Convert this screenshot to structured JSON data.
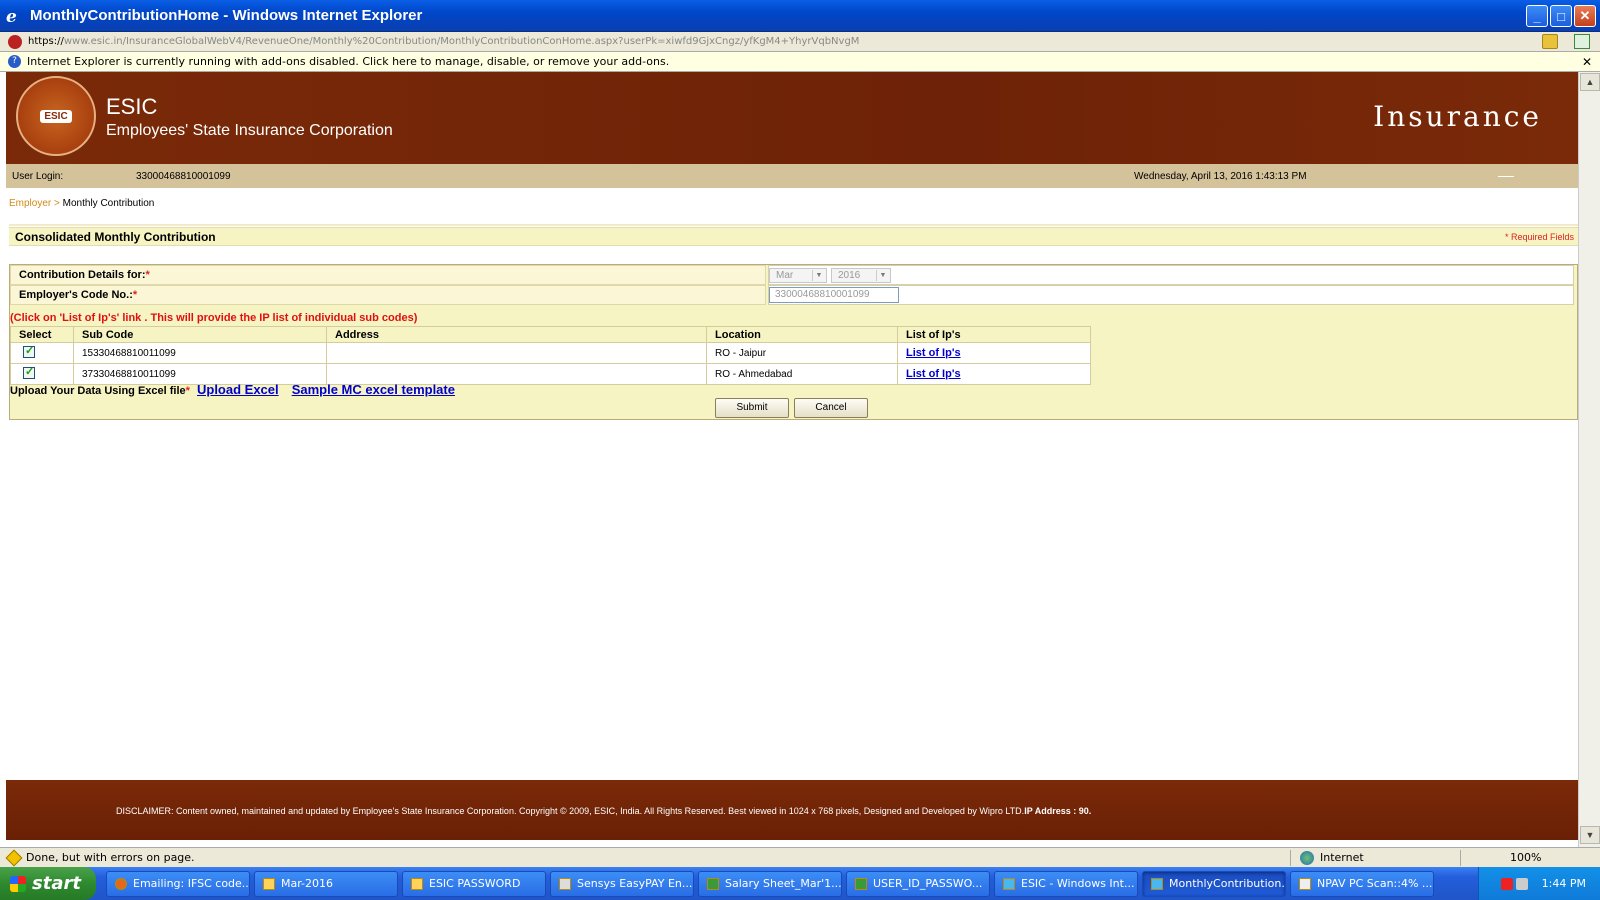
{
  "window": {
    "title": "MonthlyContributionHome - Windows Internet Explorer"
  },
  "address": {
    "scheme": "https://",
    "url": "www.esic.in/InsuranceGlobalWebV4/RevenueOne/Monthly%20Contribution/MonthlyContributionConHome.aspx?userPk=xiwfd9GjxCngz/yfKgM4+YhyrVqbNvgM"
  },
  "infobar": {
    "text": "Internet Explorer is currently running with add-ons disabled. Click here to manage, disable, or remove your add-ons."
  },
  "header": {
    "abbr": "ESIC",
    "full": "Employees' State Insurance Corporation",
    "right": "Insurance",
    "logo_text": "ESIC"
  },
  "userbar": {
    "label": "User Login:",
    "value": "33000468810001099",
    "datetime": "Wednesday, April 13, 2016 1:43:13 PM"
  },
  "breadcrumb": {
    "parent": "Employer",
    "sep": ">",
    "current": "Monthly Contribution"
  },
  "section": {
    "title": "Consolidated Monthly Contribution",
    "required": "* Required Fields"
  },
  "form": {
    "contrib_label": "Contribution Details for:",
    "month": "Mar",
    "year": "2016",
    "code_label": "Employer's Code No.:",
    "code_value": "33000468810001099",
    "required_mark": "*"
  },
  "notice": "(Click on 'List of Ip's' link . This will provide the IP list of individual sub codes)",
  "table": {
    "headers": [
      "Select",
      "Sub Code",
      "Address",
      "Location",
      "List of Ip's"
    ],
    "rows": [
      {
        "sub_code": "15330468810011099",
        "address": "",
        "location": "RO - Jaipur",
        "link": "List of Ip's"
      },
      {
        "sub_code": "37330468810011099",
        "address": "",
        "location": "RO - Ahmedabad",
        "link": "List of Ip's"
      }
    ]
  },
  "upload": {
    "label": "Upload Your Data Using Excel file",
    "upload_link": "Upload Excel",
    "sample_link": "Sample MC excel template"
  },
  "buttons": {
    "submit": "Submit",
    "cancel": "Cancel"
  },
  "footer": {
    "disclaimer": "DISCLAIMER: Content owned, maintained and updated by Employee's State Insurance Corporation. Copyright © 2009, ESIC, India. All Rights Reserved. Best viewed in 1024 x 768 pixels, Designed and Developed by Wipro LTD.",
    "ip_label": "IP Address : 90."
  },
  "status": {
    "text": "Done, but with errors on page.",
    "zone": "Internet",
    "zoom": "100%"
  },
  "taskbar": {
    "start": "start",
    "tasks": [
      "Emailing: IFSC code...",
      "Mar-2016",
      "ESIC PASSWORD",
      "Sensys EasyPAY En...",
      "Salary Sheet_Mar'1...",
      "USER_ID_PASSWO...",
      "ESIC - Windows Int...",
      "MonthlyContribution...",
      "NPAV PC Scan::4% ..."
    ],
    "clock": "1:44 PM"
  }
}
